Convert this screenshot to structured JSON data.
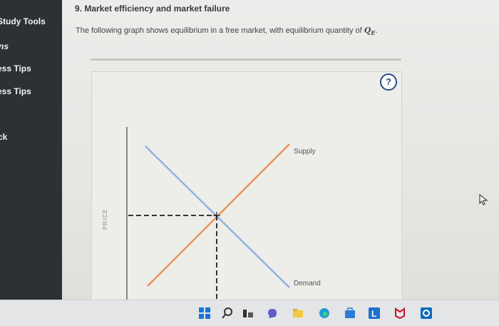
{
  "sidebar": {
    "items": [
      {
        "label": "Study Tools"
      },
      {
        "label": "ns"
      },
      {
        "label": "ess Tips"
      },
      {
        "label": "ess Tips"
      },
      {
        "label": "ck"
      }
    ]
  },
  "question": {
    "title": "9. Market efficiency and market failure",
    "text_prefix": "The following graph shows equilibrium in a free market, with equilibrium quantity of ",
    "symbol": "Q",
    "subscript": "E",
    "text_suffix": "."
  },
  "help": {
    "label": "?"
  },
  "graph": {
    "y_axis_label": "PRICE",
    "supply_label": "Supply",
    "demand_label": "Demand",
    "colors": {
      "supply": "#e8935a",
      "demand": "#8fb3df",
      "axis": "#555555",
      "dashed": "#333333"
    }
  },
  "taskbar": {
    "icons": [
      "windows-start-icon",
      "search-icon",
      "task-view-icon",
      "chat-icon",
      "file-explorer-icon",
      "edge-browser-icon",
      "store-icon",
      "learning-app-icon",
      "mcafee-icon",
      "outlook-icon"
    ]
  }
}
